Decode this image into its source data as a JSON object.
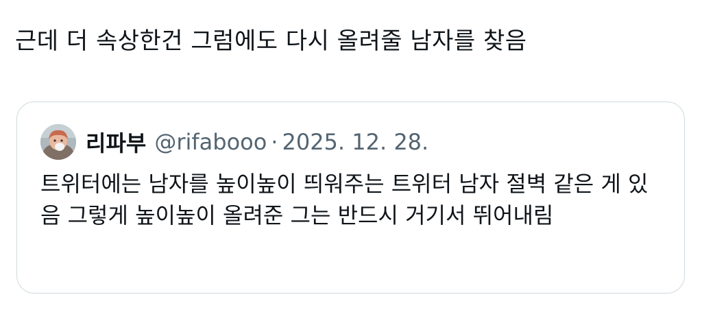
{
  "tweet": {
    "text": "근데 더 속상한건 그럼에도 다시 올려줄 남자를 찾음"
  },
  "quoted_tweet": {
    "display_name": "리파부",
    "handle": "@rifabooo",
    "separator": "·",
    "date": "2025. 12. 28.",
    "text": "트위터에는 남자를 높이높이 띄워주는 트위터 남자 절벽 같은 게 있음 그렇게 높이높이 올려준 그는 반드시 거기서 뛰어내림",
    "avatar_icon": "profile-avatar"
  },
  "colors": {
    "text_primary": "#0f1419",
    "text_secondary": "#536471",
    "border": "#cfd9de",
    "background": "#ffffff"
  }
}
